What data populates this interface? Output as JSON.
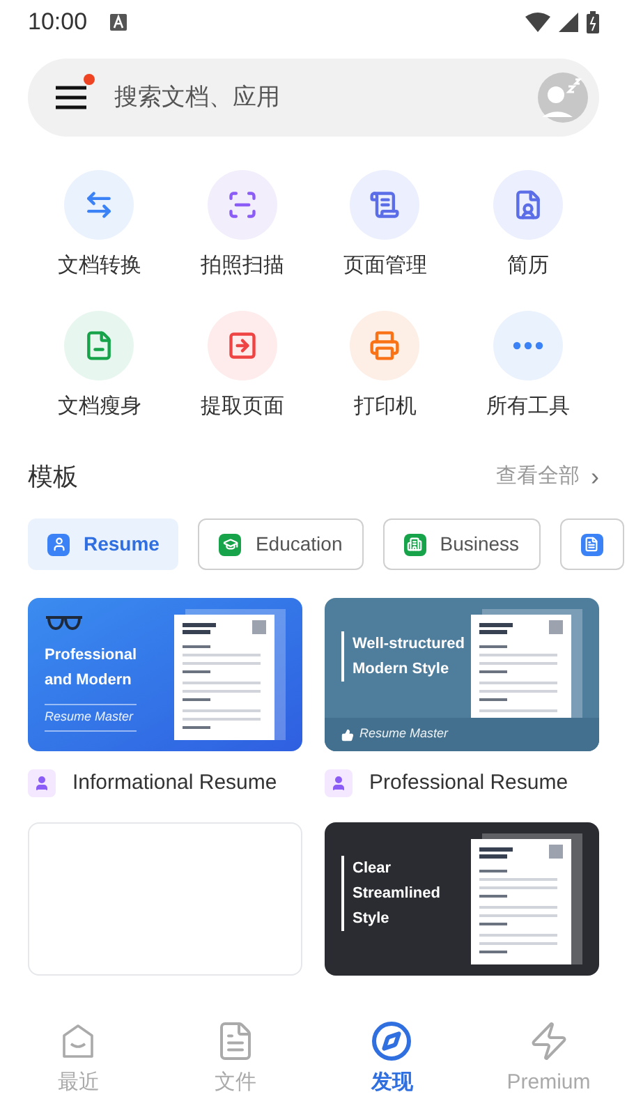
{
  "status_bar": {
    "time": "10:00"
  },
  "search": {
    "placeholder": "搜索文档、应用",
    "menu_badge": true
  },
  "tools": [
    {
      "label": "文档转换",
      "kind": "convert"
    },
    {
      "label": "拍照扫描",
      "kind": "scan"
    },
    {
      "label": "页面管理",
      "kind": "pages"
    },
    {
      "label": "简历",
      "kind": "resume"
    },
    {
      "label": "文档瘦身",
      "kind": "compress"
    },
    {
      "label": "提取页面",
      "kind": "extract"
    },
    {
      "label": "打印机",
      "kind": "print"
    },
    {
      "label": "所有工具",
      "kind": "more"
    }
  ],
  "templates": {
    "title": "模板",
    "view_all": "查看全部",
    "view_all_icon": "›",
    "chips": [
      {
        "label": "Resume",
        "selected": true,
        "color": "#3b82f6"
      },
      {
        "label": "Education",
        "selected": false,
        "color": "#16a34a"
      },
      {
        "label": "Business",
        "selected": false,
        "color": "#16a34a"
      },
      {
        "selected": false,
        "color": "#3b82f6"
      }
    ],
    "cards": [
      {
        "kind": "blue",
        "headline": [
          "Professional",
          "and Modern"
        ],
        "brand": "Resume Master",
        "title": "Informational Resume"
      },
      {
        "kind": "slate",
        "headline": [
          "Well-structured",
          "Modern Style"
        ],
        "brand": "Resume Master",
        "title": "Professional Resume"
      },
      {
        "kind": "blank"
      },
      {
        "kind": "dark",
        "headline": [
          "Clear",
          "Streamlined",
          "Style"
        ]
      }
    ]
  },
  "bottom_nav": [
    {
      "label": "最近",
      "kind": "recent",
      "selected": false
    },
    {
      "label": "文件",
      "kind": "files",
      "selected": false
    },
    {
      "label": "发现",
      "kind": "discover",
      "selected": true
    },
    {
      "label": "Premium",
      "kind": "premium",
      "selected": false
    }
  ]
}
